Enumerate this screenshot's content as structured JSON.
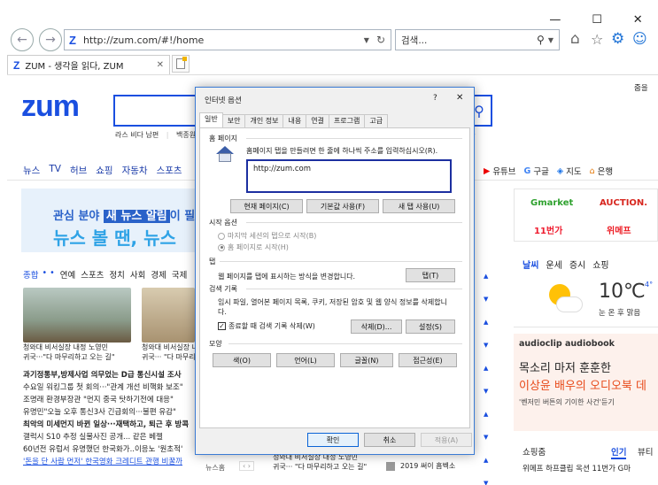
{
  "browser": {
    "address": "http://zum.com/#!/home",
    "search_placeholder": "검색...",
    "tab_title": "ZUM - 생각을 읽다, ZUM",
    "window_controls": [
      "—",
      "☐",
      "✕"
    ]
  },
  "site": {
    "logo": "zum",
    "search_sub": [
      "라스 비다 남편",
      "백종원"
    ],
    "gnb": [
      "뉴스",
      "TV",
      "허브",
      "쇼핑",
      "자동차",
      "스포츠"
    ],
    "top_right": "줌을",
    "right_links": [
      "유튜브",
      "구글",
      "지도",
      "은행"
    ],
    "banner_line1_a": "관심 분야 ",
    "banner_line1_b": "새 뉴스 알림",
    "banner_line1_c": "이 필",
    "banner_line2": "뉴스 볼 땐, 뉴스",
    "news_tabs": [
      "종합",
      "연예",
      "스포츠",
      "정치",
      "사회",
      "경제",
      "국제"
    ],
    "thumb1_caption": [
      "청와대 비서실장 내정 노영민",
      "귀국···\"다 마무리하고 오는 길\""
    ],
    "thumb2_caption": [
      "청와대 비서실장 내정 노영민",
      "귀국··· \"다 마무리하고"
    ],
    "headlines": [
      "과기정통부,방제사업 의무었는 D급 통신시설 조사",
      "수요일 워킹그룹 첫 회의···\"관계 개선 비핵화 보조\"",
      "조명래 환경부장관 \"먼지 중국 탓하기전에 대응\"",
      "유명민\"오늘 오후 통신3사 긴급회의···불편 유감\"",
      "최악의 미세먼지 바뀐 일상···재택하고, 퇴근 후 방콕",
      "갤럭시 S10 추정 실물사진 공개... 같은 베젤",
      "60년전 유럽서 유명했던 한국화가..이응노 '원초적'",
      "'돈을 단 사람 먼저' 한국영화 크레디트 관행 비꿀까"
    ],
    "bottom_label": "뉴스홈",
    "bottom_caption": [
      "청와대 비서실장 내정 노영민",
      "귀국··· \"다 마무리하고 오는 길\""
    ],
    "bottom_right": "2019 써이 흠벡소",
    "brands": [
      "Gmarket",
      "AUCTION.",
      "11번가",
      "위메프"
    ],
    "weather_tabs": [
      "날씨",
      "운세",
      "증시",
      "쇼핑"
    ],
    "temp": "10℃",
    "temp_sub": "4°",
    "weather_desc": "눈 온 후 맑음",
    "ad_logo": "audioclip audiobook",
    "ad_line1": "목소리 마저 훈훈한",
    "ad_line2": "이상윤 배우의 오디오북 데",
    "ad_line3": "'벤저민 버튼의 기이한 사건'듣기",
    "shop_title": "쇼핑줌",
    "shop_tabs": [
      "인기",
      "뷰티"
    ],
    "shop_item": "위메프 하프클립 옥션 11번가 G마"
  },
  "dialog": {
    "title": "인터넷 옵션",
    "help": "?",
    "close": "✕",
    "tabs": [
      "일반",
      "보안",
      "개인 정보",
      "내용",
      "연결",
      "프로그램",
      "고급"
    ],
    "home_label": "홈 페이지",
    "home_desc": "홈페이지 탭을 만들려면 한 줄에 하나씩 주소를 입력하십시오(R).",
    "home_url": "http://zum.com",
    "btn_current": "현재 페이지(C)",
    "btn_default": "기본값 사용(F)",
    "btn_newtab": "새 탭 사용(U)",
    "startup_label": "시작 옵션",
    "startup_opt1": "마지막 세션의 탭으로 시작(B)",
    "startup_opt2": "홈 페이지로 시작(H)",
    "tabs_label": "탭",
    "tabs_desc": "웹 페이지를 탭에 표시하는 방식을 변경합니다.",
    "btn_tabs": "탭(T)",
    "history_label": "검색 기록",
    "history_desc": "임시 파일, 열어본 페이지 목록, 쿠키, 저장된 암호 및 웹 양식 정보를 삭제합니다.",
    "history_check": "종료할 때 검색 기록 삭제(W)",
    "btn_delete": "삭제(D)...",
    "btn_settings": "설정(S)",
    "appearance_label": "모양",
    "btn_color": "색(O)",
    "btn_lang": "언어(L)",
    "btn_font": "글꼴(N)",
    "btn_access": "접근성(E)",
    "btn_ok": "확인",
    "btn_cancel": "취소",
    "btn_apply": "적용(A)"
  }
}
